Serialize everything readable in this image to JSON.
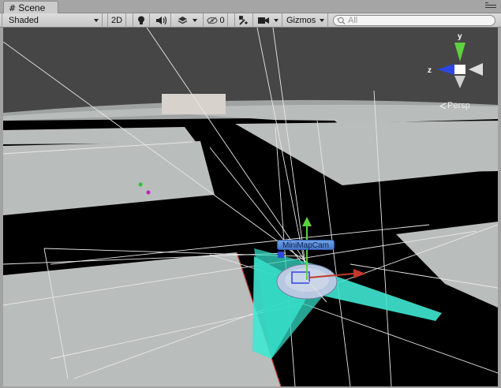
{
  "tab": {
    "label": "Scene",
    "icon": "scene-hash-icon"
  },
  "toolbar": {
    "draw_mode": "Shaded",
    "mode_2d": "2D",
    "hidden_count": "0",
    "gizmos": "Gizmos",
    "search_placeholder": "All"
  },
  "viewport": {
    "selected_object_label": "MiniMapCam",
    "projection_label": "Persp",
    "axis_labels": {
      "y": "y",
      "z": "z"
    }
  },
  "colors": {
    "sky": "#464646",
    "ground": "#000000",
    "plane": "#b9bdbc",
    "frustum": "#4ff0d8",
    "axis_y": "#5fd13f",
    "axis_z": "#2d47e0",
    "axis_x": "#c23a2a"
  }
}
